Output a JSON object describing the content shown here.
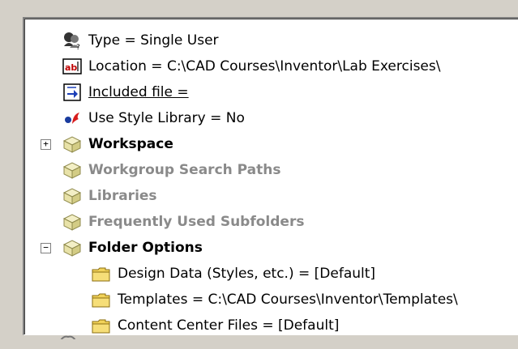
{
  "tree": {
    "properties": [
      {
        "label": "Type = Single User",
        "icon": "user-icon"
      },
      {
        "label": "Location = C:\\CAD Courses\\Inventor\\Lab Exercises\\",
        "icon": "text-field-icon"
      },
      {
        "label": "Included file = ",
        "icon": "include-file-icon"
      },
      {
        "label": "Use Style Library = No",
        "icon": "style-library-icon"
      }
    ],
    "nodes": [
      {
        "label": "Workspace",
        "state": "collapsed"
      },
      {
        "label": "Workgroup Search Paths",
        "state": "disabled"
      },
      {
        "label": "Libraries",
        "state": "disabled"
      },
      {
        "label": "Frequently Used Subfolders",
        "state": "disabled"
      },
      {
        "label": "Folder Options",
        "state": "expanded"
      }
    ],
    "folder_options": [
      {
        "label": "Design Data (Styles, etc.) = [Default]"
      },
      {
        "label": "Templates = C:\\CAD Courses\\Inventor\\Templates\\"
      },
      {
        "label": "Content Center Files = [Default]"
      }
    ],
    "expander": {
      "plus": "+",
      "minus": "−"
    }
  },
  "colors": {
    "node_icon": "#e8e2a8",
    "folder_icon": "#f2d35a",
    "disabled_text": "#8a8a8a"
  }
}
